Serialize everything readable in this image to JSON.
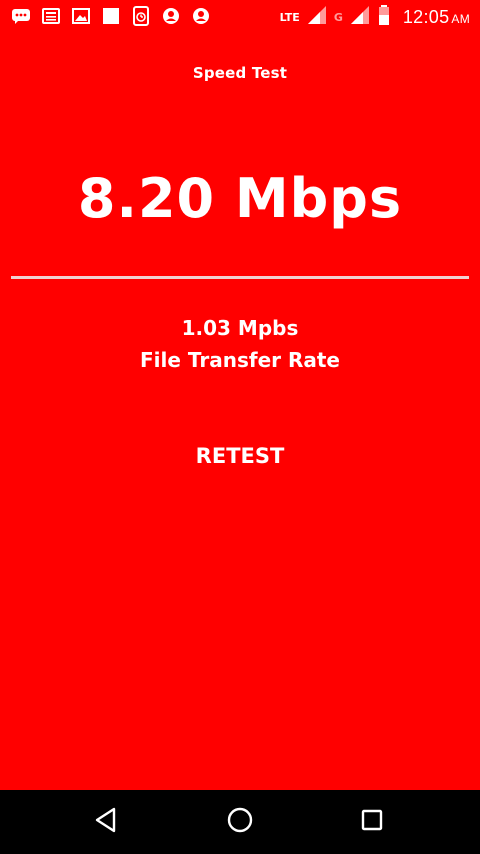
{
  "status_bar": {
    "network_lte": "LTE",
    "network_g": "G",
    "clock_time": "12:05",
    "clock_ampm": "AM",
    "icons": [
      "messaging-icon",
      "news-icon",
      "gallery-icon",
      "square-icon",
      "clock-app-icon",
      "account-icon",
      "account-icon",
      "lte-signal-icon",
      "g-signal-icon",
      "battery-icon"
    ]
  },
  "app": {
    "title": "Speed Test",
    "speed_value": "8.20 Mbps",
    "transfer_value": "1.03 Mpbs",
    "transfer_label": "File Transfer Rate",
    "retest_label": "RETEST"
  },
  "nav_bar": {
    "icons": [
      "back-icon",
      "home-icon",
      "recents-icon"
    ]
  },
  "colors": {
    "background": "#FF0000",
    "text": "#FFFFFF",
    "divider": "#F1D1D1",
    "nav_background": "#000000"
  }
}
